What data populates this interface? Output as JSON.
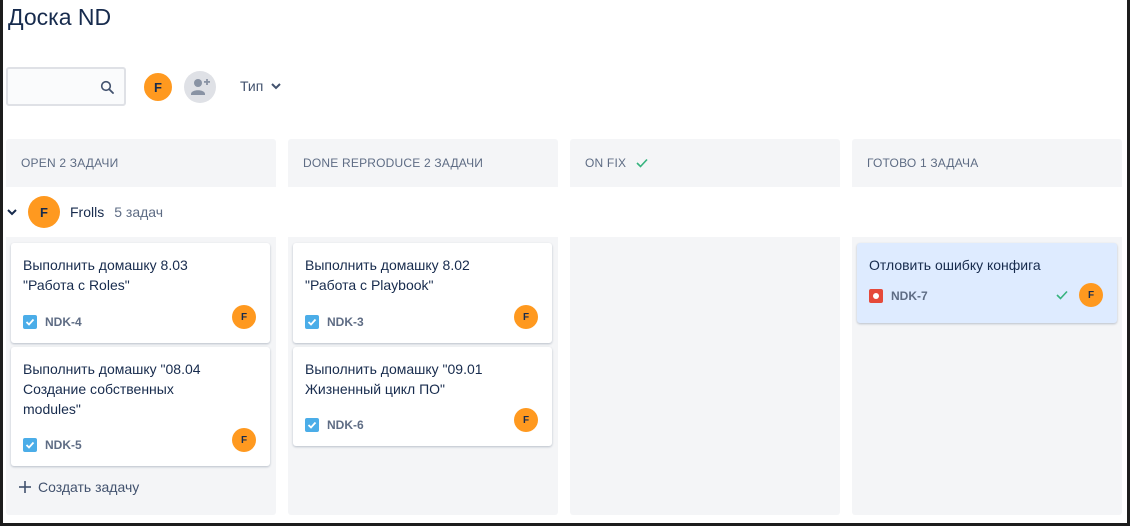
{
  "page": {
    "title": "Доска ND"
  },
  "toolbar": {
    "search_placeholder": "",
    "user_avatar_initial": "F",
    "type_filter_label": "Тип"
  },
  "columns": [
    {
      "label": "OPEN 2 ЗАДАЧИ"
    },
    {
      "label": "DONE REPRODUCE 2 ЗАДАЧИ"
    },
    {
      "label": "ON FIX"
    },
    {
      "label": "ГОТОВО 1 ЗАДАЧА"
    }
  ],
  "swimlane": {
    "avatar_initial": "F",
    "name": "Frolls",
    "count": "5 задач"
  },
  "cards": {
    "open": [
      {
        "title": "Выполнить домашку 8.03\n\"Работа с Roles\"",
        "key": "NDK-4",
        "assignee": "F"
      },
      {
        "title": "Выполнить домашку \"08.04\nСоздание собственных\nmodules\"",
        "key": "NDK-5",
        "assignee": "F"
      }
    ],
    "done_reproduce": [
      {
        "title": "Выполнить домашку 8.02\n\"Работа с Playbook\"",
        "key": "NDK-3",
        "assignee": "F"
      },
      {
        "title": "Выполнить домашку \"09.01\nЖизненный цикл ПО\"",
        "key": "NDK-6",
        "assignee": "F"
      }
    ],
    "done": [
      {
        "title": "Отловить ошибку конфига",
        "key": "NDK-7",
        "assignee": "F"
      }
    ]
  },
  "create_issue_label": "Создать задачу",
  "colors": {
    "avatar": "#ff991f",
    "task_icon": "#4bade8",
    "bug_icon": "#e5493a",
    "done_check": "#36b37e",
    "column_bg": "#f4f5f7",
    "selected_card": "#deebff"
  },
  "icons": {
    "search": "search-icon",
    "add_user": "add-user-icon",
    "chevron": "chevron-down-icon",
    "task": "task-checkbox-icon",
    "bug": "bug-icon",
    "check": "check-icon",
    "plus": "plus-icon"
  }
}
